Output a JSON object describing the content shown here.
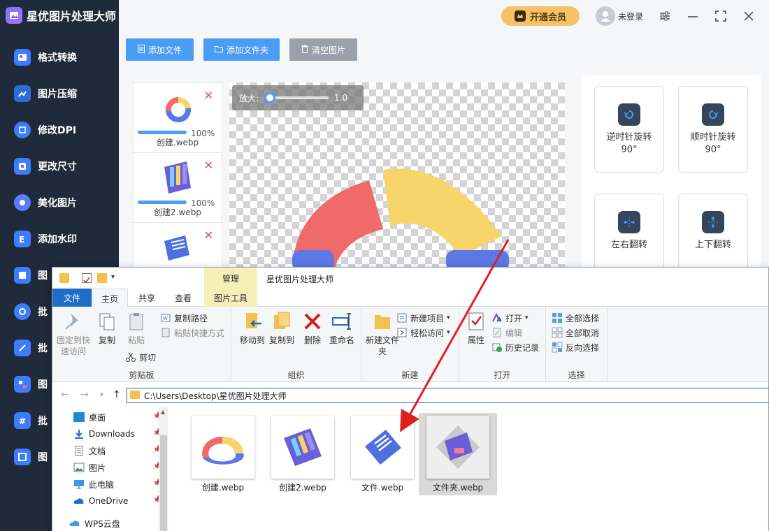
{
  "app": {
    "title": "星优图片处理大师",
    "vip_label": "开通会员",
    "user_label": "未登录"
  },
  "sidebar": {
    "items": [
      {
        "label": "格式转换",
        "icon": "image-convert-icon"
      },
      {
        "label": "图片压缩",
        "icon": "compress-icon"
      },
      {
        "label": "修改DPI",
        "icon": "dpi-icon"
      },
      {
        "label": "更改尺寸",
        "icon": "resize-icon"
      },
      {
        "label": "美化图片",
        "icon": "beautify-icon"
      },
      {
        "label": "添加水印",
        "icon": "watermark-icon"
      },
      {
        "label": "图",
        "icon": "image-tool-icon"
      },
      {
        "label": "批",
        "icon": "batch-icon"
      },
      {
        "label": "批",
        "icon": "batch-edit-icon"
      },
      {
        "label": "图",
        "icon": "image-puzzle-icon"
      },
      {
        "label": "批",
        "icon": "batch-crop-icon"
      },
      {
        "label": "图",
        "icon": "image-frame-icon"
      }
    ]
  },
  "toolbar": {
    "add_file": "添加文件",
    "add_folder": "添加文件夹",
    "clear": "清空图片"
  },
  "file_list": [
    {
      "name": "创建.webp",
      "progress": "100%"
    },
    {
      "name": "创建2.webp",
      "progress": "100%"
    },
    {
      "name": "",
      "progress": ""
    }
  ],
  "preview": {
    "zoom_label": "放大:",
    "zoom_value": "1.0"
  },
  "operations": {
    "rotate_ccw": "逆时针旋转90°",
    "rotate_cw": "顺时针旋转90°",
    "flip_h": "左右翻转",
    "flip_v": "上下翻转"
  },
  "explorer": {
    "title": "星优图片处理大师",
    "context_tab": "管理",
    "tabs": [
      "文件",
      "主页",
      "共享",
      "查看",
      "图片工具"
    ],
    "ribbon": {
      "pin": "固定到快速访问",
      "copy": "复制",
      "paste": "粘贴",
      "copy_path": "复制路径",
      "paste_shortcut": "粘贴快捷方式",
      "cut": "剪切",
      "clipboard_group": "剪贴板",
      "move_to": "移动到",
      "copy_to": "复制到",
      "delete": "删除",
      "rename": "重命名",
      "organize_group": "组织",
      "new_folder": "新建文件夹",
      "new_item": "新建项目",
      "easy_access": "轻松访问",
      "new_group": "新建",
      "properties": "属性",
      "open": "打开",
      "edit": "编辑",
      "history": "历史记录",
      "open_group": "打开",
      "select_all": "全部选择",
      "select_none": "全部取消",
      "invert_select": "反向选择",
      "select_group": "选择"
    },
    "address": "C:\\Users\\Desktop\\星优图片处理大师",
    "nav": [
      {
        "label": "桌面",
        "pinned": true
      },
      {
        "label": "Downloads",
        "pinned": true
      },
      {
        "label": "文档",
        "pinned": true
      },
      {
        "label": "图片",
        "pinned": true
      },
      {
        "label": "此电脑",
        "pinned": true
      },
      {
        "label": "OneDrive",
        "pinned": true
      },
      {
        "label": "WPS云盘",
        "pinned": false
      }
    ],
    "files": [
      {
        "name": "创建.webp",
        "selected": false
      },
      {
        "name": "创建2.webp",
        "selected": false
      },
      {
        "name": "文件.webp",
        "selected": false
      },
      {
        "name": "文件夹.webp",
        "selected": true
      }
    ]
  },
  "colors": {
    "sidebar_bg": "#1f2a3a",
    "accent_blue": "#4a9cf5",
    "vip_gold": "#f5c16a",
    "arrow_red": "#e02020"
  }
}
